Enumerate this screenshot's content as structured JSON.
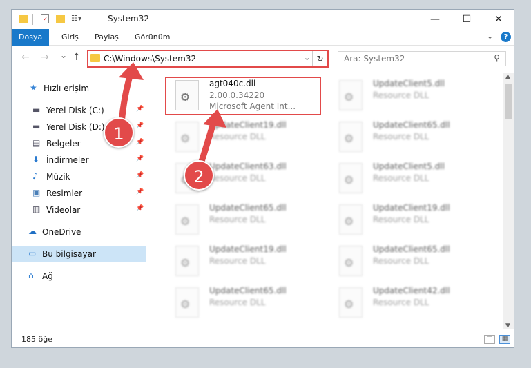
{
  "window": {
    "title": "System32",
    "controls": {
      "minimize": "—",
      "maximize": "☐",
      "close": "✕"
    }
  },
  "ribbon": {
    "tabs": [
      "Dosya",
      "Giriş",
      "Paylaş",
      "Görünüm"
    ],
    "help": "?"
  },
  "navigation": {
    "back": "←",
    "forward": "→",
    "recent": "⌄",
    "up": "↑",
    "address": "C:\\Windows\\System32",
    "refresh": "↻",
    "search_placeholder": "Ara: System32"
  },
  "sidebar": {
    "items": [
      {
        "label": "Hızlı erişim",
        "icon": "star-icon",
        "pinned": false
      },
      {
        "label": "Yerel Disk (C:)",
        "icon": "drive-icon",
        "pinned": true
      },
      {
        "label": "Yerel Disk (D:)",
        "icon": "drive-icon",
        "pinned": true
      },
      {
        "label": "Belgeler",
        "icon": "documents-icon",
        "pinned": true
      },
      {
        "label": "İndirmeler",
        "icon": "download-icon",
        "pinned": true
      },
      {
        "label": "Müzik",
        "icon": "music-icon",
        "pinned": true
      },
      {
        "label": "Resimler",
        "icon": "pictures-icon",
        "pinned": true
      },
      {
        "label": "Videolar",
        "icon": "videos-icon",
        "pinned": true
      },
      {
        "label": "OneDrive",
        "icon": "cloud-icon",
        "pinned": false
      },
      {
        "label": "Bu bilgisayar",
        "icon": "computer-icon",
        "pinned": false,
        "selected": true
      },
      {
        "label": "Ağ",
        "icon": "network-icon",
        "pinned": false
      }
    ]
  },
  "files": [
    {
      "name": "agt040c.dll",
      "line1": "2.00.0.34220",
      "line2": "Microsoft Agent Int...",
      "highlighted": true
    },
    {
      "name": "UpdateClient5.dll",
      "line1": "Resource DLL"
    },
    {
      "name": "UpdateClient19.dll",
      "line1": "Resource DLL"
    },
    {
      "name": "UpdateClient65.dll",
      "line1": "Resource DLL"
    },
    {
      "name": "UpdateClient63.dll",
      "line1": "Resource DLL"
    },
    {
      "name": "UpdateClient5.dll",
      "line1": "Resource DLL"
    },
    {
      "name": "UpdateClient65.dll",
      "line1": "Resource DLL"
    },
    {
      "name": "UpdateClient19.dll",
      "line1": "Resource DLL"
    },
    {
      "name": "UpdateClient19.dll",
      "line1": "Resource DLL"
    },
    {
      "name": "UpdateClient65.dll",
      "line1": "Resource DLL"
    },
    {
      "name": "UpdateClient65.dll",
      "line1": "Resource DLL"
    },
    {
      "name": "UpdateClient42.dll",
      "line1": "Resource DLL"
    }
  ],
  "status": {
    "count": "185 öğe"
  },
  "annotations": {
    "step1": "1",
    "step2": "2"
  },
  "colors": {
    "accent": "#1979ca",
    "highlight": "#e24a4a",
    "selection": "#cce4f7"
  }
}
